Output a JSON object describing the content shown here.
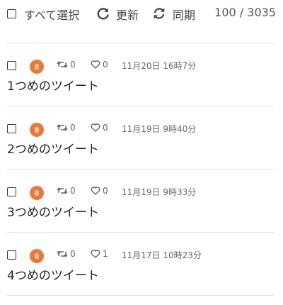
{
  "toolbar": {
    "select_all_label": "すべて選択",
    "refresh_label": "更新",
    "sync_label": "同期",
    "count": "100 / 3035"
  },
  "tweets": [
    {
      "retweets": "0",
      "likes": "0",
      "date": "11月20日 16時7分",
      "text": "1つめのツイート"
    },
    {
      "retweets": "0",
      "likes": "0",
      "date": "11月19日 9時40分",
      "text": "2つめのツイート"
    },
    {
      "retweets": "0",
      "likes": "0",
      "date": "11月19日 9時33分",
      "text": "3つめのツイート"
    },
    {
      "retweets": "0",
      "likes": "1",
      "date": "11月17日 10時23分",
      "text": "4つめのツイート"
    }
  ],
  "colors": {
    "avatar": "#e8793b",
    "divider": "#e2e2e2",
    "text": "#222222"
  },
  "icons": [
    "checkbox-icon",
    "refresh-icon",
    "sync-icon",
    "retweet-icon",
    "heart-icon",
    "avatar"
  ]
}
